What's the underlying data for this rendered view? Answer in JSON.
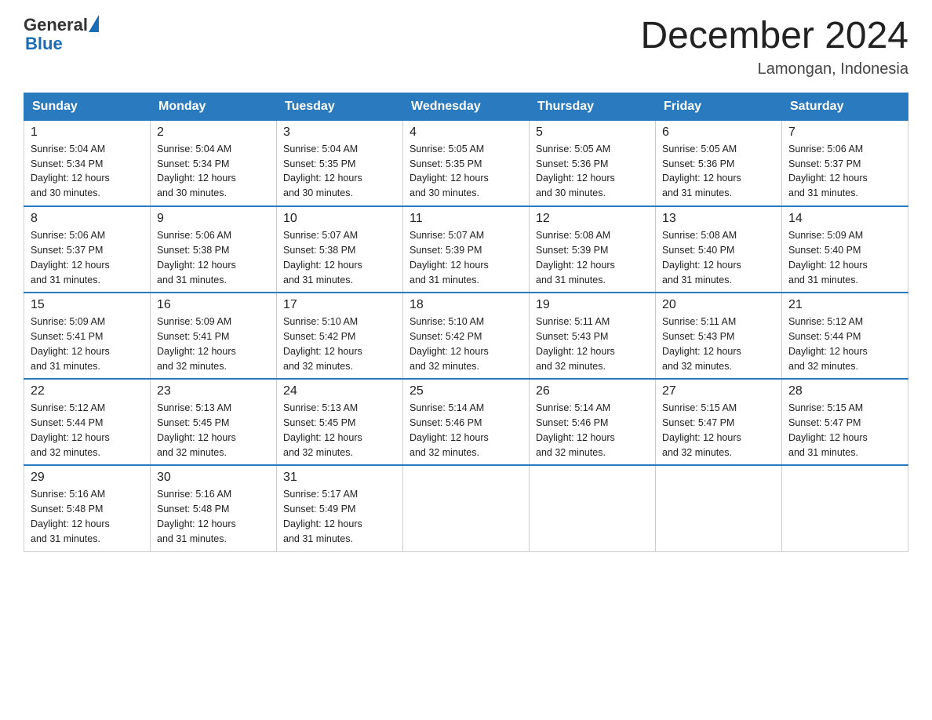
{
  "header": {
    "logo_text_general": "General",
    "logo_text_blue": "Blue",
    "month_title": "December 2024",
    "location": "Lamongan, Indonesia"
  },
  "days_of_week": [
    "Sunday",
    "Monday",
    "Tuesday",
    "Wednesday",
    "Thursday",
    "Friday",
    "Saturday"
  ],
  "weeks": [
    [
      {
        "day": "1",
        "sunrise": "5:04 AM",
        "sunset": "5:34 PM",
        "daylight": "12 hours and 30 minutes."
      },
      {
        "day": "2",
        "sunrise": "5:04 AM",
        "sunset": "5:34 PM",
        "daylight": "12 hours and 30 minutes."
      },
      {
        "day": "3",
        "sunrise": "5:04 AM",
        "sunset": "5:35 PM",
        "daylight": "12 hours and 30 minutes."
      },
      {
        "day": "4",
        "sunrise": "5:05 AM",
        "sunset": "5:35 PM",
        "daylight": "12 hours and 30 minutes."
      },
      {
        "day": "5",
        "sunrise": "5:05 AM",
        "sunset": "5:36 PM",
        "daylight": "12 hours and 30 minutes."
      },
      {
        "day": "6",
        "sunrise": "5:05 AM",
        "sunset": "5:36 PM",
        "daylight": "12 hours and 31 minutes."
      },
      {
        "day": "7",
        "sunrise": "5:06 AM",
        "sunset": "5:37 PM",
        "daylight": "12 hours and 31 minutes."
      }
    ],
    [
      {
        "day": "8",
        "sunrise": "5:06 AM",
        "sunset": "5:37 PM",
        "daylight": "12 hours and 31 minutes."
      },
      {
        "day": "9",
        "sunrise": "5:06 AM",
        "sunset": "5:38 PM",
        "daylight": "12 hours and 31 minutes."
      },
      {
        "day": "10",
        "sunrise": "5:07 AM",
        "sunset": "5:38 PM",
        "daylight": "12 hours and 31 minutes."
      },
      {
        "day": "11",
        "sunrise": "5:07 AM",
        "sunset": "5:39 PM",
        "daylight": "12 hours and 31 minutes."
      },
      {
        "day": "12",
        "sunrise": "5:08 AM",
        "sunset": "5:39 PM",
        "daylight": "12 hours and 31 minutes."
      },
      {
        "day": "13",
        "sunrise": "5:08 AM",
        "sunset": "5:40 PM",
        "daylight": "12 hours and 31 minutes."
      },
      {
        "day": "14",
        "sunrise": "5:09 AM",
        "sunset": "5:40 PM",
        "daylight": "12 hours and 31 minutes."
      }
    ],
    [
      {
        "day": "15",
        "sunrise": "5:09 AM",
        "sunset": "5:41 PM",
        "daylight": "12 hours and 31 minutes."
      },
      {
        "day": "16",
        "sunrise": "5:09 AM",
        "sunset": "5:41 PM",
        "daylight": "12 hours and 32 minutes."
      },
      {
        "day": "17",
        "sunrise": "5:10 AM",
        "sunset": "5:42 PM",
        "daylight": "12 hours and 32 minutes."
      },
      {
        "day": "18",
        "sunrise": "5:10 AM",
        "sunset": "5:42 PM",
        "daylight": "12 hours and 32 minutes."
      },
      {
        "day": "19",
        "sunrise": "5:11 AM",
        "sunset": "5:43 PM",
        "daylight": "12 hours and 32 minutes."
      },
      {
        "day": "20",
        "sunrise": "5:11 AM",
        "sunset": "5:43 PM",
        "daylight": "12 hours and 32 minutes."
      },
      {
        "day": "21",
        "sunrise": "5:12 AM",
        "sunset": "5:44 PM",
        "daylight": "12 hours and 32 minutes."
      }
    ],
    [
      {
        "day": "22",
        "sunrise": "5:12 AM",
        "sunset": "5:44 PM",
        "daylight": "12 hours and 32 minutes."
      },
      {
        "day": "23",
        "sunrise": "5:13 AM",
        "sunset": "5:45 PM",
        "daylight": "12 hours and 32 minutes."
      },
      {
        "day": "24",
        "sunrise": "5:13 AM",
        "sunset": "5:45 PM",
        "daylight": "12 hours and 32 minutes."
      },
      {
        "day": "25",
        "sunrise": "5:14 AM",
        "sunset": "5:46 PM",
        "daylight": "12 hours and 32 minutes."
      },
      {
        "day": "26",
        "sunrise": "5:14 AM",
        "sunset": "5:46 PM",
        "daylight": "12 hours and 32 minutes."
      },
      {
        "day": "27",
        "sunrise": "5:15 AM",
        "sunset": "5:47 PM",
        "daylight": "12 hours and 32 minutes."
      },
      {
        "day": "28",
        "sunrise": "5:15 AM",
        "sunset": "5:47 PM",
        "daylight": "12 hours and 31 minutes."
      }
    ],
    [
      {
        "day": "29",
        "sunrise": "5:16 AM",
        "sunset": "5:48 PM",
        "daylight": "12 hours and 31 minutes."
      },
      {
        "day": "30",
        "sunrise": "5:16 AM",
        "sunset": "5:48 PM",
        "daylight": "12 hours and 31 minutes."
      },
      {
        "day": "31",
        "sunrise": "5:17 AM",
        "sunset": "5:49 PM",
        "daylight": "12 hours and 31 minutes."
      },
      null,
      null,
      null,
      null
    ]
  ],
  "labels": {
    "sunrise": "Sunrise:",
    "sunset": "Sunset:",
    "daylight": "Daylight:"
  }
}
